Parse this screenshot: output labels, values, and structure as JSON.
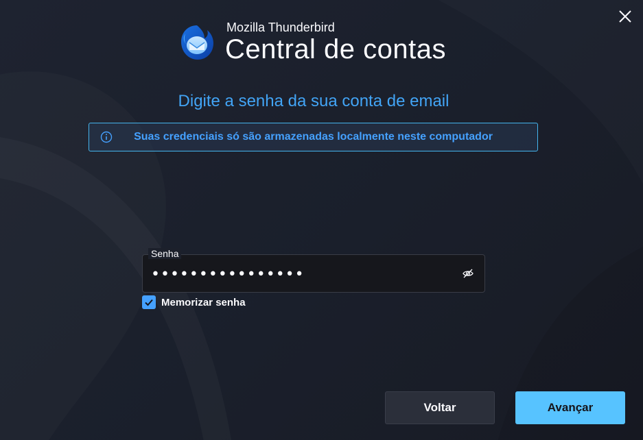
{
  "window": {
    "close_icon": "close-icon"
  },
  "brand": {
    "logo_icon": "thunderbird-logo-icon",
    "product_name": "Mozilla Thunderbird",
    "title": "Central de contas"
  },
  "heading": "Digite a senha da sua conta de email",
  "notice": {
    "icon": "info-icon",
    "text": "Suas credenciais só são armazenadas localmente neste computador"
  },
  "password": {
    "label": "Senha",
    "value": "••••••••••••••••",
    "toggle_icon": "eye-slash-icon"
  },
  "remember": {
    "label": "Memorizar senha",
    "checked": true
  },
  "buttons": {
    "back": "Voltar",
    "next": "Avançar"
  },
  "colors": {
    "accent": "#45a1ff",
    "primary_button": "#57c3ff",
    "heading": "#42a4f5",
    "background": "#1c1b22"
  }
}
